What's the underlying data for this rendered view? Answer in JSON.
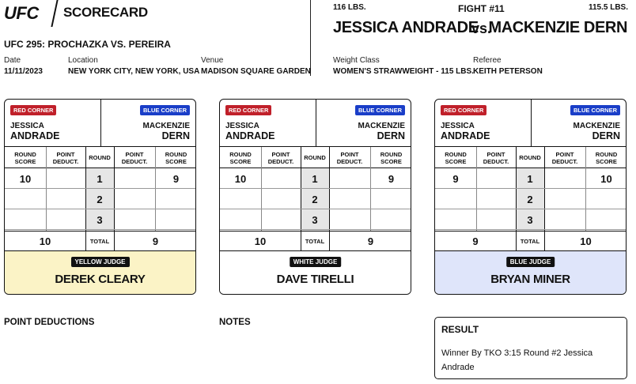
{
  "header": {
    "logo": "UFC",
    "title": "SCORECARD",
    "event": "UFC 295: PROCHAZKA VS. PEREIRA",
    "date_label": "Date",
    "date": "11/11/2023",
    "location_label": "Location",
    "location": "NEW YORK CITY, NEW YORK, USA",
    "venue_label": "Venue",
    "venue": "MADISON SQUARE GARDEN"
  },
  "fight": {
    "red_weight": "116 LBS.",
    "number": "FIGHT #11",
    "blue_weight": "115.5 LBS.",
    "red_name": "JESSICA ANDRADE",
    "vs": "vs.",
    "blue_name": "MACKENZIE DERN",
    "weight_class_label": "Weight Class",
    "weight_class": "WOMEN'S STRAWWEIGHT - 115 LBS.",
    "referee_label": "Referee",
    "referee": "KEITH PETERSON"
  },
  "labels": {
    "red_corner": "RED CORNER",
    "blue_corner": "BLUE CORNER",
    "red_first": "JESSICA",
    "red_last": "ANDRADE",
    "blue_first": "MACKENZIE",
    "blue_last": "DERN",
    "round_score": "ROUND SCORE",
    "point_deduct": "POINT DEDUCT.",
    "round": "ROUND",
    "total": "TOTAL",
    "r1": "1",
    "r2": "2",
    "r3": "3"
  },
  "judges": [
    {
      "badge": "YELLOW JUDGE",
      "name": "DEREK CLEARY",
      "color": "#fbf3c6",
      "red_scores": [
        "10",
        "",
        ""
      ],
      "blue_scores": [
        "9",
        "",
        ""
      ],
      "red_total": "10",
      "blue_total": "9"
    },
    {
      "badge": "WHITE JUDGE",
      "name": "DAVE TIRELLI",
      "color": "#ffffff",
      "red_scores": [
        "10",
        "",
        ""
      ],
      "blue_scores": [
        "9",
        "",
        ""
      ],
      "red_total": "10",
      "blue_total": "9"
    },
    {
      "badge": "BLUE JUDGE",
      "name": "BRYAN MINER",
      "color": "#dfe5fa",
      "red_scores": [
        "9",
        "",
        ""
      ],
      "blue_scores": [
        "10",
        "",
        ""
      ],
      "red_total": "9",
      "blue_total": "10"
    }
  ],
  "footer": {
    "point_deductions": "POINT DEDUCTIONS",
    "notes": "NOTES",
    "result_title": "RESULT",
    "result_text": "Winner By TKO 3:15 Round #2 Jessica Andrade"
  }
}
